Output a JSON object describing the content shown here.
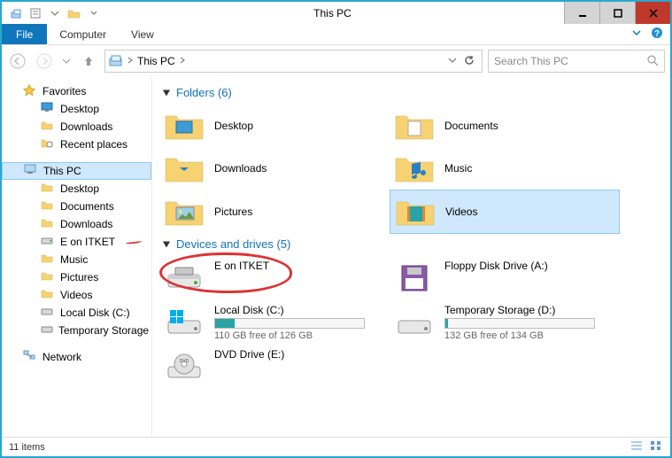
{
  "window": {
    "title": "This PC"
  },
  "menu": {
    "file": "File",
    "computer": "Computer",
    "view": "View"
  },
  "address": {
    "crumb_root": "This PC"
  },
  "search": {
    "placeholder": "Search This PC"
  },
  "sidebar": {
    "favorites": {
      "label": "Favorites",
      "items": [
        {
          "label": "Desktop"
        },
        {
          "label": "Downloads"
        },
        {
          "label": "Recent places"
        }
      ]
    },
    "thispc": {
      "label": "This PC",
      "items": [
        {
          "label": "Desktop"
        },
        {
          "label": "Documents"
        },
        {
          "label": "Downloads"
        },
        {
          "label": "E on ITKET"
        },
        {
          "label": "Music"
        },
        {
          "label": "Pictures"
        },
        {
          "label": "Videos"
        },
        {
          "label": "Local Disk (C:)"
        },
        {
          "label": "Temporary Storage ("
        }
      ]
    },
    "network": {
      "label": "Network"
    }
  },
  "sections": {
    "folders": {
      "heading": "Folders (6)",
      "items": [
        {
          "label": "Desktop"
        },
        {
          "label": "Documents"
        },
        {
          "label": "Downloads"
        },
        {
          "label": "Music"
        },
        {
          "label": "Pictures"
        },
        {
          "label": "Videos"
        }
      ]
    },
    "drives": {
      "heading": "Devices and drives (5)",
      "items": [
        {
          "label": "E on ITKET",
          "sub": ""
        },
        {
          "label": "Floppy Disk Drive (A:)",
          "sub": ""
        },
        {
          "label": "Local Disk (C:)",
          "sub": "110 GB free of 126 GB",
          "fill_pct": 13
        },
        {
          "label": "Temporary Storage (D:)",
          "sub": "132 GB free of 134 GB",
          "fill_pct": 2
        },
        {
          "label": "DVD Drive (E:)",
          "sub": ""
        }
      ]
    }
  },
  "status": {
    "text": "11 items"
  }
}
